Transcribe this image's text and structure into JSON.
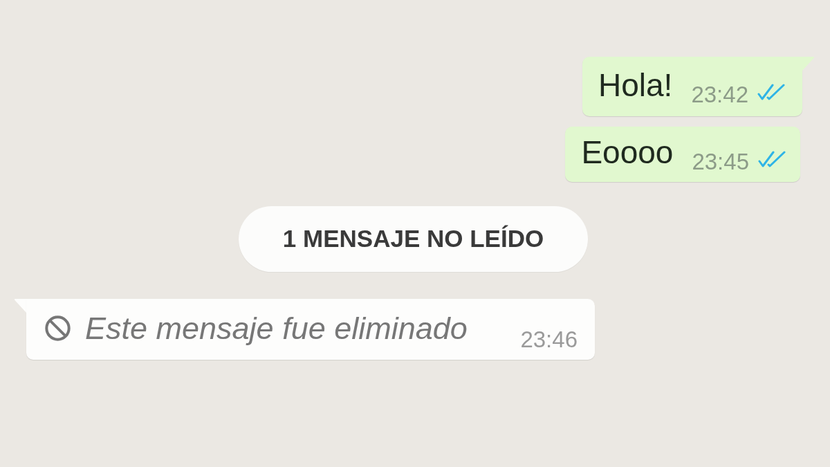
{
  "messages": [
    {
      "kind": "outgoing",
      "text": "Hola!",
      "time": "23:42",
      "read": true
    },
    {
      "kind": "outgoing",
      "text": "Eoooo",
      "time": "23:45",
      "read": true
    },
    {
      "kind": "unread_divider",
      "text": "1 MENSAJE NO LEÍDO"
    },
    {
      "kind": "deleted",
      "text": "Este mensaje fue eliminado",
      "time": "23:46"
    }
  ]
}
